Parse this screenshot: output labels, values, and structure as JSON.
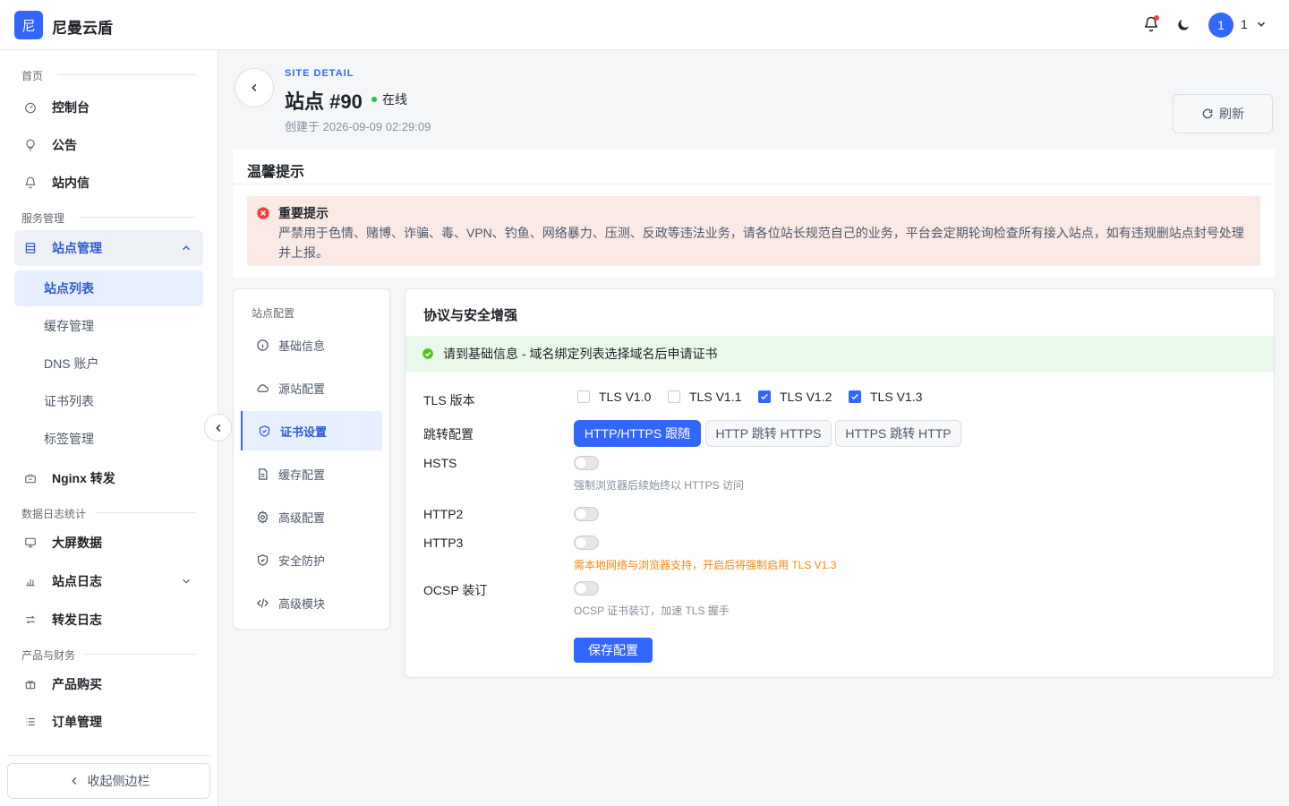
{
  "app": {
    "logo_char": "尼",
    "title": "尼曼云盾"
  },
  "header": {
    "user_avatar": "1",
    "user_name": "1"
  },
  "sidebar": {
    "groups": {
      "home": "首页",
      "service": "服务管理",
      "stats": "数据日志统计",
      "product": "产品与财务"
    },
    "items": {
      "dashboard": "控制台",
      "announcement": "公告",
      "messages": "站内信",
      "site_mgmt": "站点管理",
      "site_list": "站点列表",
      "cache_mgmt": "缓存管理",
      "dns_account": "DNS 账户",
      "cert_list": "证书列表",
      "tag_mgmt": "标签管理",
      "nginx": "Nginx 转发",
      "big_screen": "大屏数据",
      "site_logs": "站点日志",
      "forward_logs": "转发日志",
      "product_buy": "产品购买",
      "order_mgmt": "订单管理"
    },
    "collapse_label": "收起侧边栏"
  },
  "page": {
    "eyebrow": "SITE DETAIL",
    "title": "站点 #90",
    "status": "在线",
    "created": "创建于 2026-09-09 02:29:09",
    "refresh": "刷新"
  },
  "notice": {
    "card_title": "温馨提示",
    "alert_title": "重要提示",
    "alert_body": "严禁用于色情、赌博、诈骗、毒、VPN、钓鱼、网络暴力、压测、反政等违法业务，请各位站长规范自己的业务，平台会定期轮询检查所有接入站点，如有违规删站点封号处理并上报。"
  },
  "config_menu": {
    "label": "站点配置",
    "items": [
      "基础信息",
      "源站配置",
      "证书设置",
      "缓存配置",
      "高级配置",
      "安全防护",
      "高级模块"
    ],
    "active_index": 2
  },
  "panel": {
    "title": "协议与安全增强",
    "success_msg": "请到基础信息 - 域名绑定列表选择域名后申请证书",
    "tls_label": "TLS 版本",
    "tls_options": [
      {
        "label": "TLS V1.0",
        "checked": false
      },
      {
        "label": "TLS V1.1",
        "checked": false
      },
      {
        "label": "TLS V1.2",
        "checked": true
      },
      {
        "label": "TLS V1.3",
        "checked": true
      }
    ],
    "redirect_label": "跳转配置",
    "redirect_options": [
      "HTTP/HTTPS 跟随",
      "HTTP 跳转 HTTPS",
      "HTTPS 跳转 HTTP"
    ],
    "redirect_selected": 0,
    "hsts_label": "HSTS",
    "hsts_on": false,
    "hsts_hint": "强制浏览器后续始终以 HTTPS 访问",
    "http2_label": "HTTP2",
    "http2_on": false,
    "http3_label": "HTTP3",
    "http3_on": false,
    "http3_hint": "需本地网络与浏览器支持，开启后将强制启用 TLS V1.3",
    "ocsp_label": "OCSP 装订",
    "ocsp_on": false,
    "ocsp_hint": "OCSP 证书装订，加速 TLS 握手",
    "save_label": "保存配置"
  },
  "colors": {
    "primary": "#3366ff",
    "online": "#23c343",
    "error": "#f53f3f",
    "warning": "#f7890f",
    "success": "#52c41a"
  }
}
